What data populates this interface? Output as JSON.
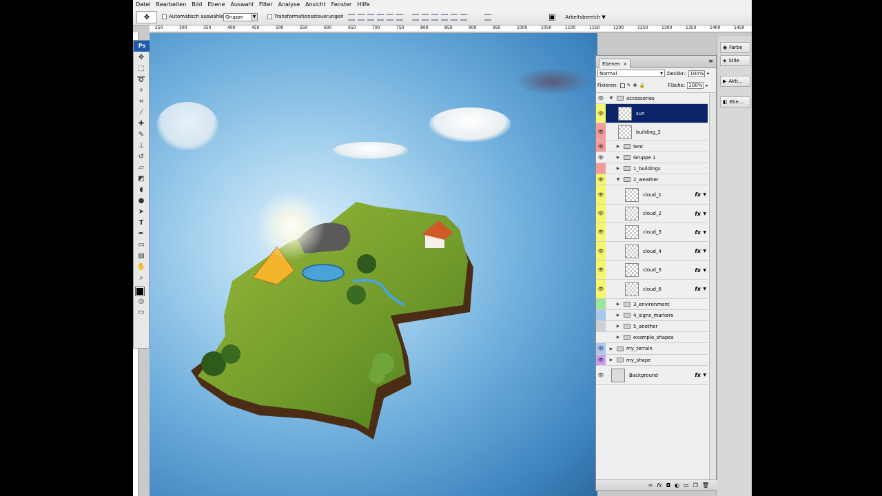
{
  "menu": [
    "Datei",
    "Bearbeiten",
    "Bild",
    "Ebene",
    "Auswahl",
    "Filter",
    "Analyse",
    "Ansicht",
    "Fenster",
    "Hilfe"
  ],
  "options": {
    "auto_select_label": "Automatisch auswählen:",
    "auto_select_value": "Gruppe",
    "transform_label": "Transformationssteuerungen",
    "workspace_label": "Arbeitsbereich"
  },
  "ruler": [
    "250",
    "300",
    "350",
    "400",
    "450",
    "500",
    "550",
    "600",
    "650",
    "700",
    "750",
    "800",
    "850",
    "900",
    "950",
    "1000",
    "1050",
    "1100",
    "1150",
    "1200",
    "1250",
    "1300",
    "1350",
    "1400",
    "1450"
  ],
  "toolbox": {
    "logo": "Ps"
  },
  "dock": {
    "color": "Farbe",
    "styles": "Stile",
    "actions": "Akti...",
    "layers": "Ebe..."
  },
  "layers_panel": {
    "tab": "Ebenen",
    "blend_mode": "Normal",
    "opacity_label": "Deckkr.:",
    "opacity_value": "100%",
    "lock_label": "Fixieren:",
    "fill_label": "Fläche:",
    "fill_value": "100%",
    "layers": [
      {
        "name": "accessories",
        "type": "group",
        "open": true,
        "indent": 0,
        "color": "#efefef",
        "visible": true
      },
      {
        "name": "sun",
        "type": "layer",
        "indent": 1,
        "color": "#f5f56e",
        "visible": true,
        "selected": true
      },
      {
        "name": "building_2",
        "type": "layer",
        "indent": 1,
        "color": "#f59a9a",
        "visible": true
      },
      {
        "name": "tent",
        "type": "group",
        "indent": 1,
        "color": "#f59a9a",
        "visible": true
      },
      {
        "name": "Gruppe 1",
        "type": "group",
        "indent": 1,
        "color": "#efefef",
        "visible": true
      },
      {
        "name": "1_buildings",
        "type": "group",
        "indent": 1,
        "color": "#f59a9a",
        "visible": false
      },
      {
        "name": "2_weather",
        "type": "group",
        "open": true,
        "indent": 1,
        "color": "#f5f56e",
        "visible": true
      },
      {
        "name": "cloud_1",
        "type": "layer",
        "indent": 2,
        "fx": true,
        "color": "#f5f56e",
        "visible": true
      },
      {
        "name": "cloud_2",
        "type": "layer",
        "indent": 2,
        "fx": true,
        "color": "#f5f56e",
        "visible": true
      },
      {
        "name": "cloud_3",
        "type": "layer",
        "indent": 2,
        "fx": true,
        "color": "#f5f56e",
        "visible": true
      },
      {
        "name": "cloud_4",
        "type": "layer",
        "indent": 2,
        "fx": true,
        "color": "#f5f56e",
        "visible": true
      },
      {
        "name": "cloud_5",
        "type": "layer",
        "indent": 2,
        "fx": true,
        "color": "#f5f56e",
        "visible": true
      },
      {
        "name": "cloud_6",
        "type": "layer",
        "indent": 2,
        "fx": true,
        "color": "#f5f56e",
        "visible": true
      },
      {
        "name": "3_environment",
        "type": "group",
        "indent": 1,
        "color": "#9ae69a",
        "visible": false
      },
      {
        "name": "4_signs_markers",
        "type": "group",
        "indent": 1,
        "color": "#a9c8f0",
        "visible": false
      },
      {
        "name": "5_another",
        "type": "group",
        "indent": 1,
        "color": "#d0d0d0",
        "visible": false
      },
      {
        "name": "example_shapes",
        "type": "group",
        "indent": 1,
        "color": "#efefef",
        "visible": false
      },
      {
        "name": "my_terrain",
        "type": "group",
        "indent": 0,
        "color": "#a9c8f0",
        "visible": true
      },
      {
        "name": "my_shape",
        "type": "group",
        "indent": 0,
        "color": "#c9a0f0",
        "visible": true
      },
      {
        "name": "Background",
        "type": "layer",
        "indent": 0,
        "fx": true,
        "color": "#efefef",
        "visible": true,
        "bg": true
      }
    ]
  }
}
